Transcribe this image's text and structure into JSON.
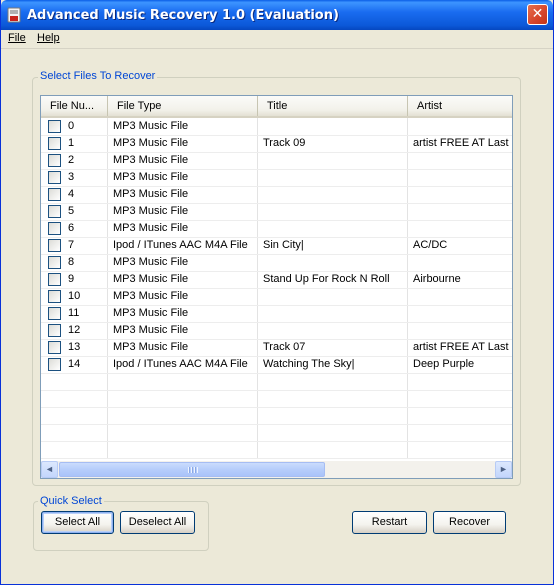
{
  "window": {
    "title": "Advanced Music Recovery 1.0 (Evaluation)",
    "close_glyph": "✕"
  },
  "menu": {
    "file": "File",
    "help": "Help"
  },
  "files_group": {
    "label": "Select Files To Recover",
    "columns": [
      "File Nu...",
      "File Type",
      "Title",
      "Artist"
    ],
    "rows": [
      {
        "num": "0",
        "type": "MP3 Music File",
        "title": "",
        "artist": ""
      },
      {
        "num": "1",
        "type": "MP3 Music File",
        "title": "Track 09",
        "artist": "artist FREE AT Last m"
      },
      {
        "num": "2",
        "type": "MP3 Music File",
        "title": "",
        "artist": ""
      },
      {
        "num": "3",
        "type": "MP3 Music File",
        "title": "",
        "artist": ""
      },
      {
        "num": "4",
        "type": "MP3 Music File",
        "title": "",
        "artist": ""
      },
      {
        "num": "5",
        "type": "MP3 Music File",
        "title": "",
        "artist": ""
      },
      {
        "num": "6",
        "type": "MP3 Music File",
        "title": "",
        "artist": ""
      },
      {
        "num": "7",
        "type": "Ipod / ITunes AAC M4A File",
        "title": "Sin City|",
        "artist": "AC/DC"
      },
      {
        "num": "8",
        "type": "MP3 Music File",
        "title": "",
        "artist": ""
      },
      {
        "num": "9",
        "type": "MP3 Music File",
        "title": "Stand Up For Rock N Roll",
        "artist": "Airbourne"
      },
      {
        "num": "10",
        "type": "MP3 Music File",
        "title": "",
        "artist": ""
      },
      {
        "num": "11",
        "type": "MP3 Music File",
        "title": "",
        "artist": ""
      },
      {
        "num": "12",
        "type": "MP3 Music File",
        "title": "",
        "artist": ""
      },
      {
        "num": "13",
        "type": "MP3 Music File",
        "title": "Track 07",
        "artist": "artist FREE AT Last m"
      },
      {
        "num": "14",
        "type": "Ipod / ITunes AAC M4A File",
        "title": "Watching The Sky|",
        "artist": "Deep Purple"
      }
    ]
  },
  "quick_select": {
    "label": "Quick Select",
    "select_all": "Select All",
    "deselect_all": "Deselect All"
  },
  "actions": {
    "restart": "Restart",
    "recover": "Recover"
  },
  "scrollbar": {
    "left_arrow": "◄",
    "right_arrow": "►"
  },
  "colors": {
    "accent": "#0046d5",
    "titlebar": "#0b58d8",
    "face": "#ece9d8"
  }
}
